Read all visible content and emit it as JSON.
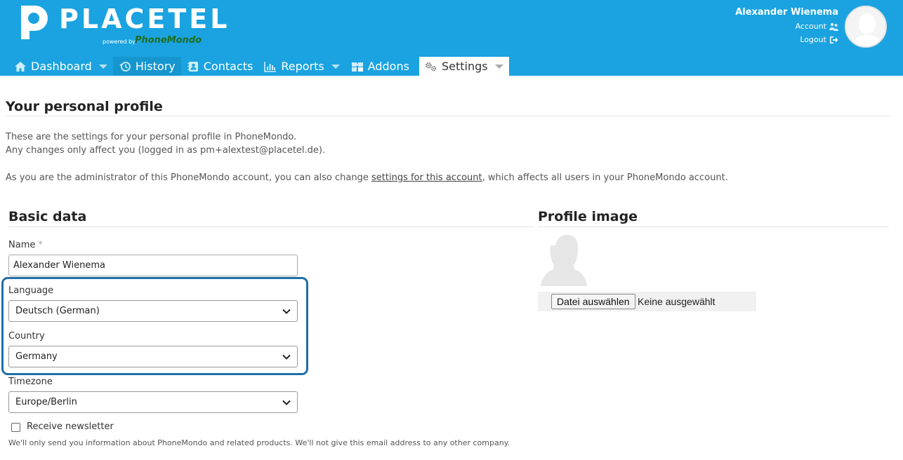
{
  "brand": {
    "name": "PLACETEL",
    "powered_by": "powered by",
    "partner": "PhoneMondo",
    "header_color": "#1aa3e0"
  },
  "user": {
    "name": "Alexander Wienema",
    "account_label": "Account",
    "logout_label": "Logout"
  },
  "nav": {
    "items": [
      {
        "label": "Dashboard",
        "icon": "home-icon"
      },
      {
        "label": "History",
        "icon": "history-icon"
      },
      {
        "label": "Contacts",
        "icon": "contacts-icon"
      },
      {
        "label": "Reports",
        "icon": "bar-chart-icon"
      },
      {
        "label": "Addons",
        "icon": "puzzle-icon"
      },
      {
        "label": "Settings",
        "icon": "gears-icon"
      }
    ],
    "active": "Settings"
  },
  "page": {
    "title": "Your personal profile",
    "intro_line1": "These are the settings for your personal profile in PhoneMondo.",
    "intro_line2": "Any changes only affect you (logged in as pm+alextest@placetel.de).",
    "admin_prefix": "As you are the administrator of this PhoneMondo account, you can also change ",
    "admin_link": "settings for this account",
    "admin_suffix": ", which affects all users in your PhoneMondo account."
  },
  "basic": {
    "title": "Basic data",
    "name_label": "Name",
    "name_required": "*",
    "name_value": "Alexander Wienema",
    "language_label": "Language",
    "language_value": "Deutsch (German)",
    "country_label": "Country",
    "country_value": "Germany",
    "timezone_label": "Timezone",
    "timezone_value": "Europe/Berlin",
    "newsletter_label": "Receive newsletter",
    "newsletter_checked": false,
    "newsletter_help": "We'll only send you information about PhoneMondo and related products. We'll not give this email address to any other company."
  },
  "profile_image": {
    "title": "Profile image",
    "choose_button": "Datei auswählen",
    "no_file": "Keine ausgewählt"
  }
}
